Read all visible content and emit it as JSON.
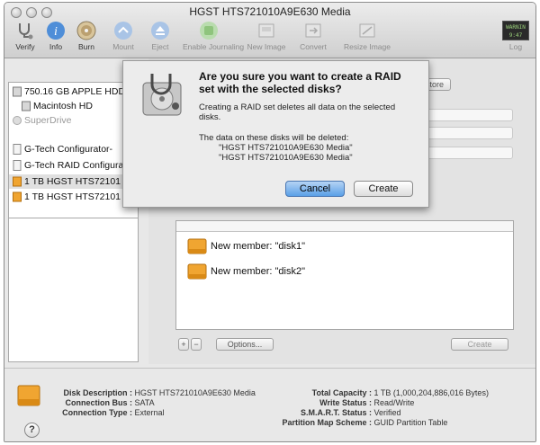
{
  "window": {
    "title": "HGST HTS721010A9E630 Media"
  },
  "toolbar": {
    "items": [
      {
        "label": "Verify",
        "icon": "stethoscope-icon",
        "enabled": true
      },
      {
        "label": "Info",
        "icon": "info-icon",
        "enabled": true
      },
      {
        "label": "Burn",
        "icon": "burn-disc-icon",
        "enabled": true
      },
      {
        "label": "Mount",
        "icon": "mount-icon",
        "enabled": false
      },
      {
        "label": "Eject",
        "icon": "eject-icon",
        "enabled": false
      },
      {
        "label": "Enable Journaling",
        "icon": "journaling-icon",
        "enabled": false
      },
      {
        "label": "New Image",
        "icon": "new-image-icon",
        "enabled": false
      },
      {
        "label": "Convert",
        "icon": "convert-icon",
        "enabled": false
      },
      {
        "label": "Resize Image",
        "icon": "resize-image-icon",
        "enabled": false
      }
    ],
    "log_label": "Log",
    "log_badge": "WARNIN 9:47"
  },
  "sidebar": {
    "items": [
      {
        "label": "750.16 GB APPLE HDD",
        "type": "internal-disk",
        "dim": false
      },
      {
        "label": "Macintosh HD",
        "type": "volume",
        "dim": false
      },
      {
        "label": "SuperDrive",
        "type": "optical",
        "dim": true
      },
      {
        "label": "G-Tech Configurator-",
        "type": "image",
        "dim": false
      },
      {
        "label": "G-Tech RAID Configurat",
        "type": "image",
        "dim": false
      },
      {
        "label": "1 TB HGST HTS72101",
        "type": "external-disk",
        "dim": false,
        "selected": true
      },
      {
        "label": "1 TB HGST HTS72101",
        "type": "external-disk",
        "dim": false,
        "selected": false
      }
    ]
  },
  "main": {
    "restore_tab": "store",
    "members": [
      {
        "label": "New member: \"disk1\""
      },
      {
        "label": "New member: \"disk2\""
      }
    ],
    "add_label": "+",
    "remove_label": "−",
    "options_label": "Options...",
    "create_label": "Create"
  },
  "dialog": {
    "title": "Are you sure you want to create a RAID set with the selected disks?",
    "message": "Creating a RAID set deletes all data on the selected disks.",
    "data_note": "The data on these disks will be deleted:",
    "disks": [
      "\"HGST HTS721010A9E630 Media\"",
      "\"HGST HTS721010A9E630 Media\""
    ],
    "cancel_label": "Cancel",
    "create_label": "Create",
    "accent": "#5aa0e7"
  },
  "info": {
    "left": [
      {
        "key": "Disk Description :",
        "value": "HGST HTS721010A9E630 Media"
      },
      {
        "key": "Connection Bus :",
        "value": "SATA"
      },
      {
        "key": "Connection Type :",
        "value": "External"
      }
    ],
    "right": [
      {
        "key": "Total Capacity :",
        "value": "1 TB (1,000,204,886,016 Bytes)"
      },
      {
        "key": "Write Status :",
        "value": "Read/Write"
      },
      {
        "key": "S.M.A.R.T. Status :",
        "value": "Verified"
      },
      {
        "key": "Partition Map Scheme :",
        "value": "GUID Partition Table"
      }
    ],
    "help_label": "?"
  }
}
